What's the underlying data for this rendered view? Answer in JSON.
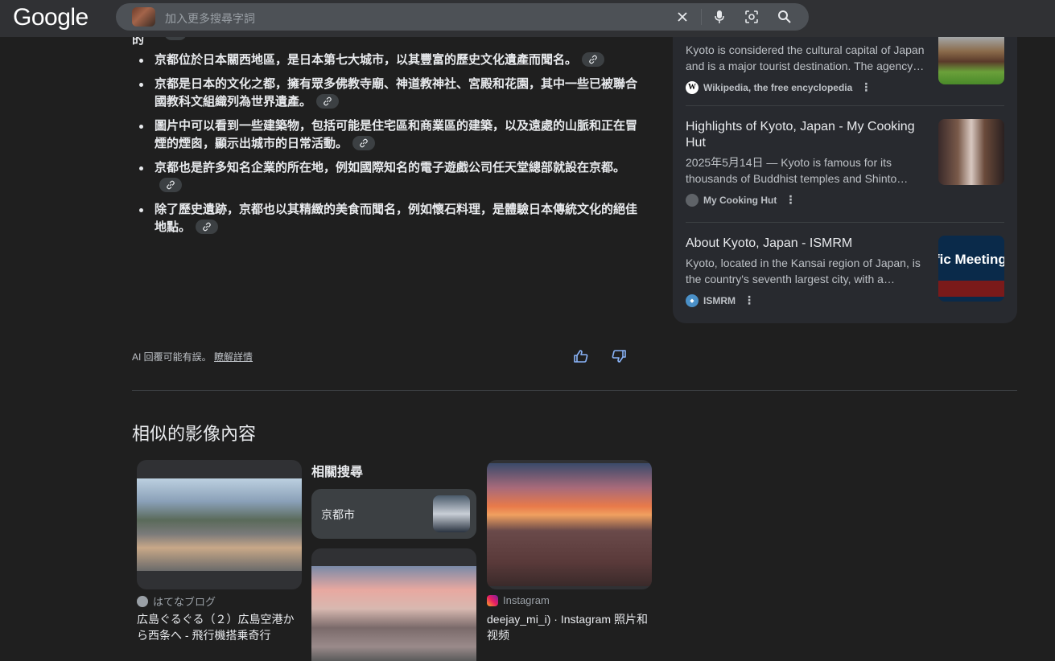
{
  "header": {
    "logo": "Google",
    "search_placeholder": "加入更多搜尋字詞"
  },
  "answer": {
    "bullets": [
      "京都位於日本關西地區，是日本第七大城市，以其豐富的歷史文化遺產而聞名。",
      "京都是日本的文化之都，擁有眾多佛教寺廟、神道教神社、宮殿和花園，其中一些已被聯合國教科文組織列為世界遺產。",
      "圖片中可以看到一些建築物，包括可能是住宅區和商業區的建築，以及遠處的山脈和正在冒煙的煙囪，顯示出城市的日常活動。",
      "京都也是許多知名企業的所在地，例如國際知名的電子遊戲公司任天堂總部就設在京都。",
      "除了歷史遺跡，京都也以其精緻的美食而聞名，例如懷石料理，是體驗日本傳統文化的絕佳地點。"
    ],
    "disclaimer": "AI 回覆可能有誤。",
    "learn_more": "瞭解詳情"
  },
  "sources": [
    {
      "title": "",
      "desc": "Kyoto is considered the cultural capital of Japan and is a major tourist destination. The agency…",
      "site": "Wikipedia, the free encyclopedia"
    },
    {
      "title": "Highlights of Kyoto, Japan - My Cooking Hut",
      "desc": "2025年5月14日 — Kyoto is famous for its thousands of Buddhist temples and Shinto…",
      "site": "My Cooking Hut"
    },
    {
      "title": "About Kyoto, Japan - ISMRM",
      "desc": "Kyoto, located in the Kansai region of Japan, is the country's seventh largest city, with a…",
      "site": "ISMRM",
      "thumb_text": "fic Meeting"
    }
  ],
  "similar": {
    "title": "相似的影像內容",
    "related_label": "相關搜尋",
    "related_chip": "京都市",
    "cards": [
      {
        "source": "はてなブログ",
        "title": "広島ぐるぐる（２）広島空港から西条へ - 飛行機搭乗奇行"
      },
      {
        "source": "Instagram",
        "title": "deejay_mi_i) · Instagram 照片和视频"
      }
    ]
  },
  "colors": {
    "background": "#1f1f1f",
    "header": "#303134",
    "panel": "#282a2f"
  }
}
